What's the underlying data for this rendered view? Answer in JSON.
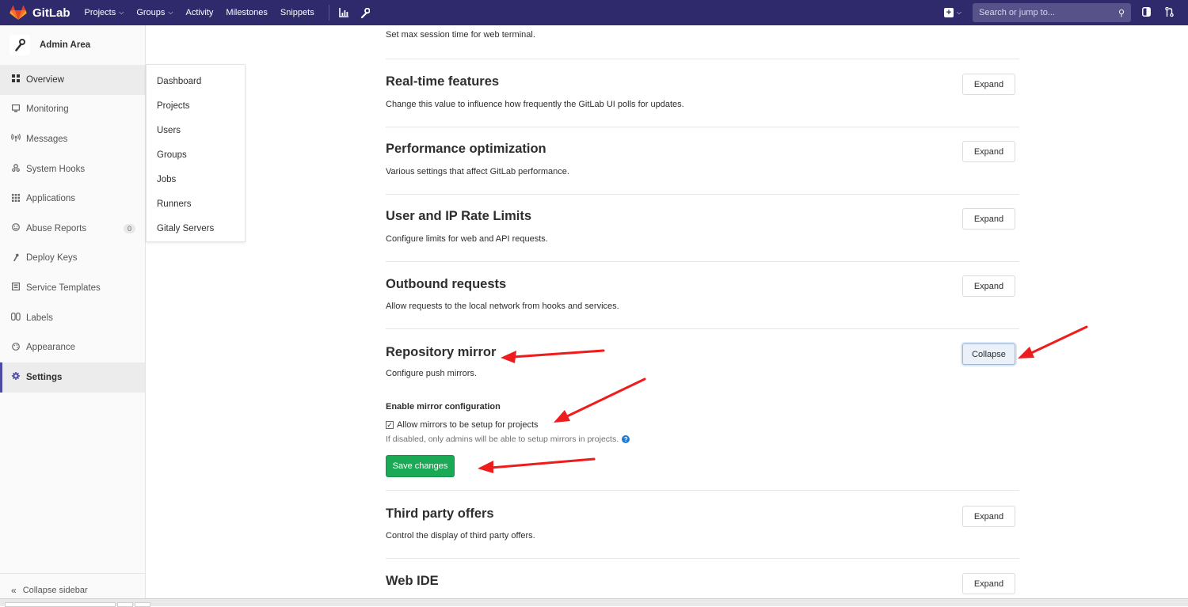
{
  "navbar": {
    "brand": "GitLab",
    "links": [
      {
        "label": "Projects",
        "dropdown": true
      },
      {
        "label": "Groups",
        "dropdown": true
      },
      {
        "label": "Activity",
        "dropdown": false
      },
      {
        "label": "Milestones",
        "dropdown": false
      },
      {
        "label": "Snippets",
        "dropdown": false
      }
    ],
    "search_placeholder": "Search or jump to...",
    "bg_color": "#2f2a6b"
  },
  "sidebar": {
    "title": "Admin Area",
    "items": [
      {
        "label": "Overview",
        "icon": "grid-icon"
      },
      {
        "label": "Monitoring",
        "icon": "monitor-icon"
      },
      {
        "label": "Messages",
        "icon": "broadcast-icon"
      },
      {
        "label": "System Hooks",
        "icon": "hook-icon"
      },
      {
        "label": "Applications",
        "icon": "apps-icon"
      },
      {
        "label": "Abuse Reports",
        "icon": "smiley-icon",
        "badge": "0"
      },
      {
        "label": "Deploy Keys",
        "icon": "key-icon"
      },
      {
        "label": "Service Templates",
        "icon": "template-icon"
      },
      {
        "label": "Labels",
        "icon": "label-icon"
      },
      {
        "label": "Appearance",
        "icon": "palette-icon"
      },
      {
        "label": "Settings",
        "icon": "gear-icon"
      }
    ],
    "collapse_label": "Collapse sidebar"
  },
  "flyout": {
    "items": [
      "Dashboard",
      "Projects",
      "Users",
      "Groups",
      "Jobs",
      "Runners",
      "Gitaly Servers"
    ]
  },
  "content": {
    "top_desc": "Set max session time for web terminal.",
    "sections": [
      {
        "title": "Real-time features",
        "desc": "Change this value to influence how frequently the GitLab UI polls for updates.",
        "button": "Expand"
      },
      {
        "title": "Performance optimization",
        "desc": "Various settings that affect GitLab performance.",
        "button": "Expand"
      },
      {
        "title": "User and IP Rate Limits",
        "desc": "Configure limits for web and API requests.",
        "button": "Expand"
      },
      {
        "title": "Outbound requests",
        "desc": "Allow requests to the local network from hooks and services.",
        "button": "Expand"
      },
      {
        "title": "Repository mirror",
        "desc": "Configure push mirrors.",
        "button": "Collapse"
      },
      {
        "title": "Third party offers",
        "desc": "Control the display of third party offers.",
        "button": "Expand"
      },
      {
        "title": "Web IDE",
        "desc": "",
        "button": "Expand"
      }
    ],
    "mirror": {
      "label": "Enable mirror configuration",
      "checkbox_label": "Allow mirrors to be setup for projects",
      "checked": true,
      "help": "If disabled, only admins will be able to setup mirrors in projects.",
      "save_label": "Save changes"
    }
  },
  "colors": {
    "accent": "#4b4ba3",
    "save_green": "#1aaa55",
    "annotation_red": "#ee1c1c"
  }
}
